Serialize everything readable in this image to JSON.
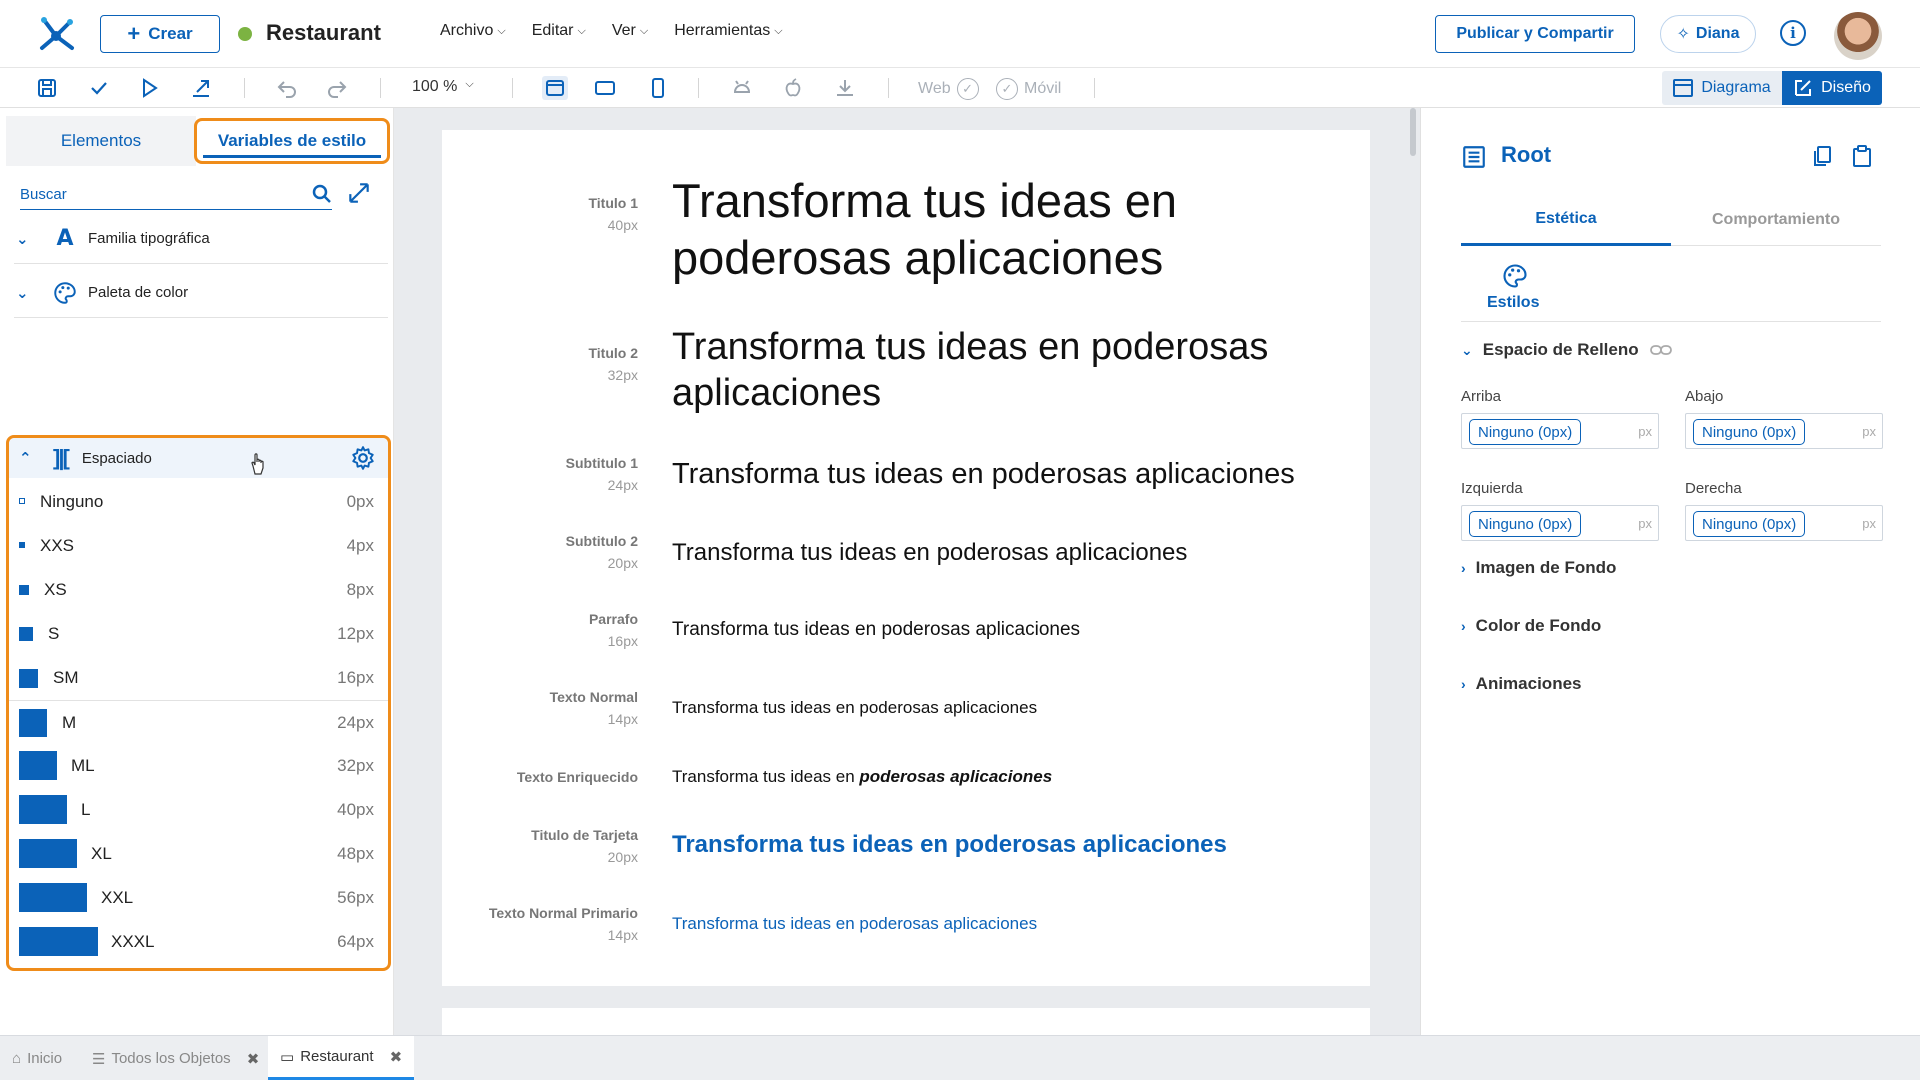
{
  "header": {
    "create_label": "Crear",
    "app_title": "Restaurant",
    "status_color": "#7cb342",
    "menus": [
      "Archivo",
      "Editar",
      "Ver",
      "Herramientas"
    ],
    "publish_label": "Publicar y Compartir",
    "assistant_label": "Diana",
    "info_glyph": "i"
  },
  "toolbar": {
    "zoom": "100 %",
    "web_label": "Web",
    "mobile_label": "Móvil",
    "diagram_label": "Diagrama",
    "design_label": "Diseño",
    "icons": [
      "save-icon",
      "check-icon",
      "play-icon",
      "export-icon",
      "undo-icon",
      "redo-icon",
      "desktop-icon",
      "tablet-icon",
      "phone-icon",
      "android-icon",
      "apple-icon",
      "download-icon"
    ]
  },
  "left_panel": {
    "tabs": [
      "Elementos",
      "Variables de estilo"
    ],
    "search_placeholder": "Buscar",
    "sections": [
      {
        "label": "Familia tipográfica",
        "icon": "font-icon"
      },
      {
        "label": "Paleta de color",
        "icon": "palette-icon"
      }
    ],
    "spacing": {
      "label": "Espaciado",
      "items": [
        {
          "name": "Ninguno",
          "value": "0px"
        },
        {
          "name": "XXS",
          "value": "4px"
        },
        {
          "name": "XS",
          "value": "8px"
        },
        {
          "name": "S",
          "value": "12px"
        },
        {
          "name": "SM",
          "value": "16px"
        },
        {
          "name": "M",
          "value": "24px"
        },
        {
          "name": "ML",
          "value": "32px"
        },
        {
          "name": "L",
          "value": "40px"
        },
        {
          "name": "XL",
          "value": "48px"
        },
        {
          "name": "XXL",
          "value": "56px"
        },
        {
          "name": "XXXL",
          "value": "64px"
        }
      ]
    }
  },
  "canvas": {
    "rows": [
      {
        "name": "Titulo 1",
        "size": "40px",
        "text": "Transforma tus ideas en poderosas aplicaciones"
      },
      {
        "name": "Titulo 2",
        "size": "32px",
        "text": "Transforma tus ideas en poderosas aplicaciones"
      },
      {
        "name": "Subtitulo 1",
        "size": "24px",
        "text": "Transforma tus ideas en poderosas aplicaciones"
      },
      {
        "name": "Subtitulo 2",
        "size": "20px",
        "text": "Transforma tus ideas en poderosas aplicaciones"
      },
      {
        "name": "Parrafo",
        "size": "16px",
        "text": "Transforma tus ideas en poderosas aplicaciones"
      },
      {
        "name": "Texto Normal",
        "size": "14px",
        "text": "Transforma tus ideas en poderosas aplicaciones"
      },
      {
        "name": "Texto Enriquecido",
        "size": "",
        "text_plain": "Transforma tus ideas en ",
        "text_emph": "poderosas aplicaciones"
      },
      {
        "name": "Titulo de Tarjeta",
        "size": "20px",
        "text": "Transforma tus ideas en poderosas aplicaciones"
      },
      {
        "name": "Texto Normal Primario",
        "size": "14px",
        "text": "Transforma tus ideas en poderosas aplicaciones"
      }
    ],
    "primary_color": "#0b62b8"
  },
  "right_panel": {
    "title": "Root",
    "tabs": [
      "Estética",
      "Comportamiento"
    ],
    "styles_label": "Estilos",
    "padding": {
      "label": "Espacio de Relleno",
      "fields": [
        {
          "label": "Arriba",
          "value": "Ninguno (0px)",
          "unit": "px"
        },
        {
          "label": "Abajo",
          "value": "Ninguno (0px)",
          "unit": "px"
        },
        {
          "label": "Izquierda",
          "value": "Ninguno (0px)",
          "unit": "px"
        },
        {
          "label": "Derecha",
          "value": "Ninguno (0px)",
          "unit": "px"
        }
      ]
    },
    "collapsed_sections": [
      "Imagen de Fondo",
      "Color de Fondo",
      "Animaciones"
    ]
  },
  "bottom_tabs": [
    {
      "label": "Inicio",
      "icon": "home-icon"
    },
    {
      "label": "Todos los Objetos",
      "icon": "list-icon"
    },
    {
      "label": "Restaurant",
      "icon": "folder-icon"
    }
  ],
  "colors": {
    "accent": "#0b62b8",
    "highlight": "#ef8c1a"
  }
}
